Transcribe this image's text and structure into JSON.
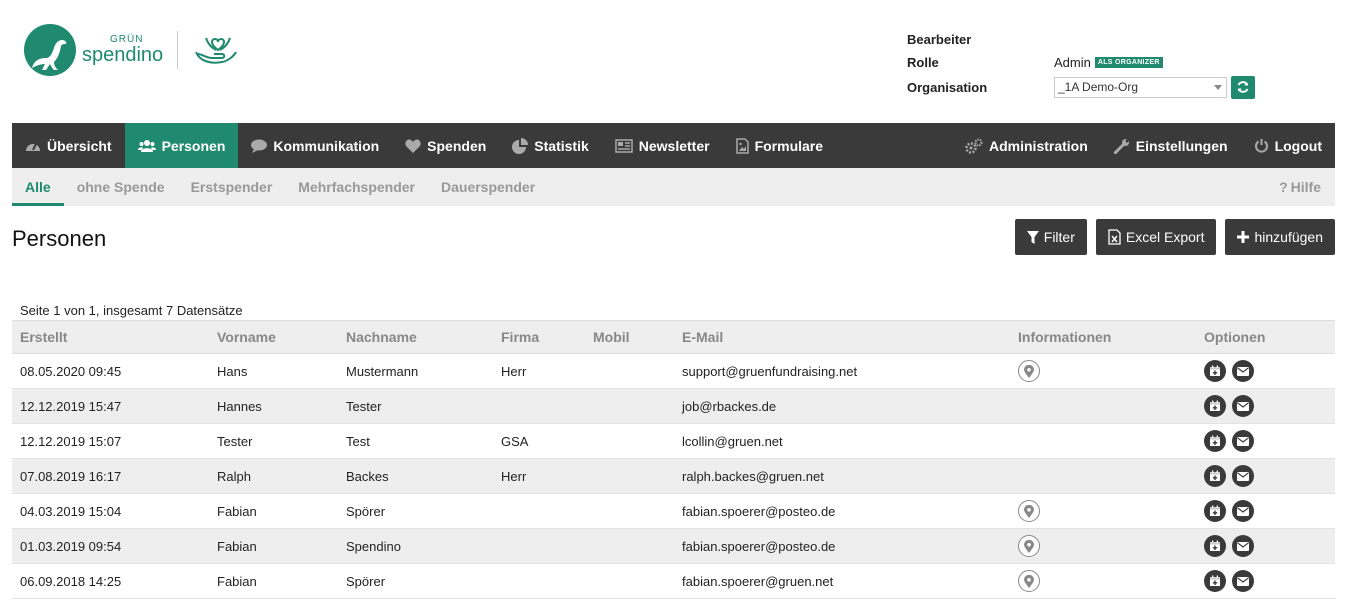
{
  "brand": {
    "logo_top": "GRÜN",
    "logo_main": "spendino"
  },
  "meta": {
    "bearbeiter_label": "Bearbeiter",
    "rolle_label": "Rolle",
    "rolle_value": "Admin",
    "rolle_badge": "ALS ORGANIZER",
    "organisation_label": "Organisation",
    "organisation_value": "_1A Demo-Org"
  },
  "nav": {
    "left": [
      {
        "label": "Übersicht",
        "icon": "dashboard-icon"
      },
      {
        "label": "Personen",
        "icon": "users-icon",
        "active": true
      },
      {
        "label": "Kommunikation",
        "icon": "chat-icon"
      },
      {
        "label": "Spenden",
        "icon": "heart-icon"
      },
      {
        "label": "Statistik",
        "icon": "pie-chart-icon"
      },
      {
        "label": "Newsletter",
        "icon": "newspaper-icon"
      },
      {
        "label": "Formulare",
        "icon": "image-file-icon"
      }
    ],
    "right": [
      {
        "label": "Administration",
        "icon": "cogs-icon"
      },
      {
        "label": "Einstellungen",
        "icon": "wrench-icon"
      },
      {
        "label": "Logout",
        "icon": "power-icon"
      }
    ]
  },
  "subnav": {
    "tabs": [
      "Alle",
      "ohne Spende",
      "Erstspender",
      "Mehrfachspender",
      "Dauerspender"
    ],
    "help": "Hilfe"
  },
  "page": {
    "title": "Personen",
    "filter_label": "Filter",
    "export_label": "Excel Export",
    "add_label": "hinzufügen",
    "pager": "Seite 1 von 1, insgesamt 7 Datensätze"
  },
  "table": {
    "columns": [
      "Erstellt",
      "Vorname",
      "Nachname",
      "Firma",
      "Mobil",
      "E-Mail",
      "Informationen",
      "Optionen"
    ],
    "rows": [
      {
        "erstellt": "08.05.2020 09:45",
        "vorname": "Hans",
        "nachname": "Mustermann",
        "firma": "Herr",
        "mobil": "",
        "email": "support@gruenfundraising.net",
        "info": true
      },
      {
        "erstellt": "12.12.2019 15:47",
        "vorname": "Hannes",
        "nachname": "Tester",
        "firma": "",
        "mobil": "",
        "email": "job@rbackes.de",
        "info": false
      },
      {
        "erstellt": "12.12.2019 15:07",
        "vorname": "Tester",
        "nachname": "Test",
        "firma": "GSA",
        "mobil": "",
        "email": "lcollin@gruen.net",
        "info": false
      },
      {
        "erstellt": "07.08.2019 16:17",
        "vorname": "Ralph",
        "nachname": "Backes",
        "firma": "Herr",
        "mobil": "",
        "email": "ralph.backes@gruen.net",
        "info": false
      },
      {
        "erstellt": "04.03.2019 15:04",
        "vorname": "Fabian",
        "nachname": "Spörer",
        "firma": "",
        "mobil": "",
        "email": "fabian.spoerer@posteo.de",
        "info": true
      },
      {
        "erstellt": "01.03.2019 09:54",
        "vorname": "Fabian",
        "nachname": "Spendino",
        "firma": "",
        "mobil": "",
        "email": "fabian.spoerer@posteo.de",
        "info": true
      },
      {
        "erstellt": "06.09.2018 14:25",
        "vorname": "Fabian",
        "nachname": "Spörer",
        "firma": "",
        "mobil": "",
        "email": "fabian.spoerer@gruen.net",
        "info": true
      }
    ]
  },
  "colors": {
    "accent": "#1f8a70",
    "nav_bg": "#3a3a3a",
    "subnav_bg": "#eeeeee"
  }
}
